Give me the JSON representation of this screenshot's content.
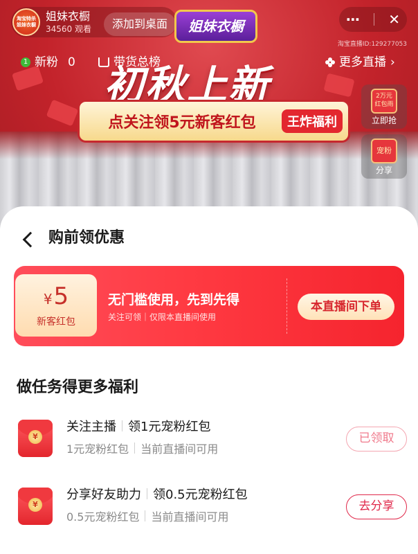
{
  "live": {
    "anchor_name": "姐妹衣橱",
    "viewers": "34560 观看",
    "avatar_text": "淘宝特杀 姐妹衣橱",
    "add_to_desktop": "添加到桌面",
    "brand_badge": "姐妹衣橱",
    "more_icon": "⋯",
    "close_icon": "✕",
    "room_id": "淘宝直播ID:129277053",
    "new_fans_label": "新粉",
    "new_fans_count": "0",
    "goods_rank": "带货总榜",
    "more_live": "更多直播",
    "banner_title": "初秋上新",
    "banner_sub": "点关注领5元新客红包",
    "banner_tag": "王炸福利",
    "widgets": [
      {
        "icon_text": "2万元 红包雨",
        "label": "立即抢"
      },
      {
        "icon_text": "宠粉",
        "label": "分享"
      }
    ]
  },
  "sheet": {
    "title": "购前领优惠",
    "coupon": {
      "currency": "¥",
      "amount": "5",
      "type": "新客红包",
      "headline": "无门槛使用，先到先得",
      "note": "关注可领｜仅限本直播间使用",
      "button": "本直播间下单"
    },
    "tasks_heading": "做任务得更多福利",
    "tasks": [
      {
        "title_a": "关注主播",
        "title_b": "领1元宠粉红包",
        "sub_a": "1元宠粉红包",
        "sub_b": "当前直播间可用",
        "button": "已领取",
        "coin": "¥"
      },
      {
        "title_a": "分享好友助力",
        "title_b": "领0.5元宠粉红包",
        "sub_a": "0.5元宠粉红包",
        "sub_b": "当前直播间可用",
        "button": "去分享",
        "coin": "¥"
      }
    ]
  },
  "colors": {
    "live_red": "#c3232b",
    "coupon_red": "#ff3a42",
    "claimed_pink": "#f07a8c",
    "action_red": "#e0284a"
  }
}
